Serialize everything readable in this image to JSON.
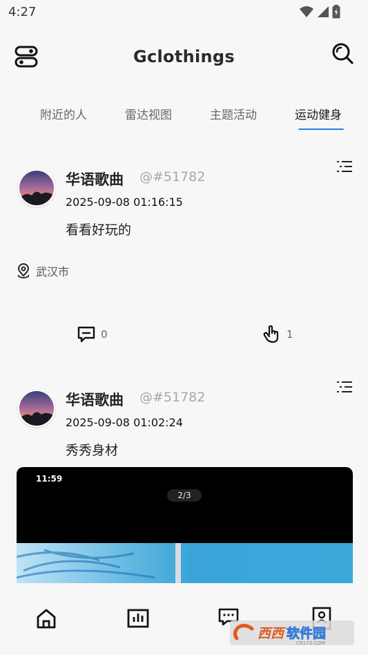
{
  "status_bar": {
    "time": "4:27"
  },
  "header": {
    "title": "Gclothings"
  },
  "tabs": [
    {
      "label": "附近的人",
      "active": false
    },
    {
      "label": "雷达视图",
      "active": false
    },
    {
      "label": "主题活动",
      "active": false
    },
    {
      "label": "运动健身",
      "active": true
    }
  ],
  "posts": [
    {
      "author": "华语歌曲",
      "handle": "@#51782",
      "time": "2025-09-08 01:16:15",
      "text": "看看好玩的",
      "location": "武汉市",
      "comments": "0",
      "likes": "1"
    },
    {
      "author": "华语歌曲",
      "handle": "@#51782",
      "time": "2025-09-08 01:02:24",
      "text": "秀秀身材",
      "media": {
        "status_time": "11:59",
        "counter": "2/3"
      }
    }
  ],
  "colors": {
    "accent": "#2b7de9",
    "background": "#f7f7f8"
  },
  "bottom_nav": [
    "home-icon",
    "chart-icon",
    "message-icon",
    "contact-icon"
  ],
  "watermark": {
    "text": "西西软件园",
    "subtext": "CR173.COM"
  }
}
